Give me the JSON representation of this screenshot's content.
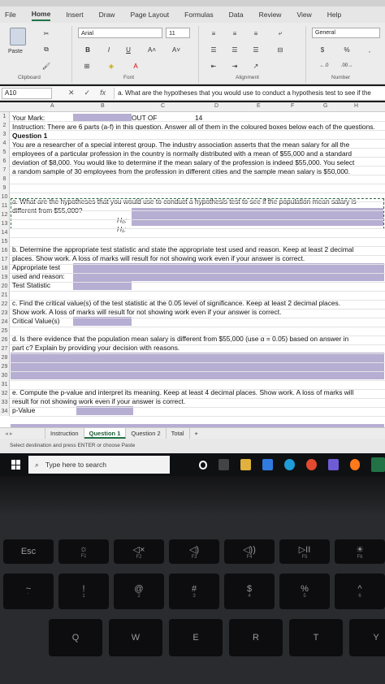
{
  "menu": {
    "items": [
      "File",
      "Home",
      "Insert",
      "Draw",
      "Page Layout",
      "Formulas",
      "Data",
      "Review",
      "View",
      "Help"
    ],
    "active": "Home"
  },
  "ribbon": {
    "paste_label": "Paste",
    "font_name": "Arial",
    "font_size": "11",
    "number_format": "General",
    "groups": [
      "Clipboard",
      "Font",
      "Alignment",
      "Number"
    ],
    "bold": "B",
    "italic": "I",
    "underline": "U",
    "currency": "$",
    "percent": "%"
  },
  "formula_bar": {
    "cell_ref": "A10",
    "cancel": "✕",
    "enter": "✓",
    "fx": "fx",
    "content": "a. What are the hypotheses that you would use to conduct a hypothesis test to see if the"
  },
  "columns": [
    "A",
    "B",
    "C",
    "D",
    "E",
    "F",
    "G",
    "H"
  ],
  "rows": {
    "numbers": [
      "1",
      "2",
      "3",
      "4",
      "5",
      "6",
      "7",
      "8",
      "9",
      "10",
      "11",
      "12",
      "13",
      "14",
      "15",
      "16",
      "17",
      "18",
      "19",
      "20",
      "21",
      "22",
      "23",
      "24",
      "25",
      "26",
      "27",
      "28",
      "29",
      "30",
      "31",
      "32",
      "33",
      "34"
    ],
    "r1_your_mark": "Your Mark:",
    "r1_out_of": "OUT OF",
    "r1_total": "14",
    "r2": "Instruction: There are 6 parts (a-f) in this question. Answer all of them in the coloured boxes below each of the questions.",
    "r3": "Question 1",
    "r4": "You are a researcher of a special interest group. The industry association asserts that the mean salary for all the",
    "r5": "employees of a particular profession in the country is normally distributed with a mean of $55,000 and a standard",
    "r6": "deviation of $8,000. You would like to determine if the mean salary of the profession is indeed $55,000. You select",
    "r7": "a random sample of 30 employees from the profession in different cities and the sample mean salary is $50,000.",
    "r10": "a. What are the hypotheses that you would use to conduct a hypothesis test to see if the population mean salary is",
    "r11": "different from $55,000?",
    "r12_label": "H₀:",
    "r13_label": "H₁:",
    "r15": "b. Determine the appropriate test statistic and state the appropriate test used and reason.  Keep at least 2 decimal",
    "r16": "places.  Show work.  A loss of marks will result for not showing work even if your answer is correct.",
    "r17": "Appropriate test",
    "r18": "used and reason:",
    "r19": "Test Statistic",
    "r21": "c. Find the critical value(s) of the test statistic at the 0.05 level of significance.  Keep at least 2 decimal places.",
    "r22": "Show work.  A loss of marks will result for not showing work even if your answer is correct.",
    "r23": "Critical Value(s)",
    "r25": "d. Is there evidence that the population mean salary is different from $55,000 (use α = 0.05) based on answer in",
    "r26": "part c?  Explain by providing your decision with reasons.",
    "r31": "e. Compute the p-value and interpret its meaning.  Keep at least 4 decimal places.  Show work.  A loss of marks will",
    "r32": "result for not showing work even if your answer is correct.",
    "r33": "p-Value"
  },
  "sheet_tabs": [
    "Instruction",
    "Question 1",
    "Question 2",
    "Total"
  ],
  "active_tab": "Question 1",
  "add_sheet": "+",
  "status_text": "Select destination and press ENTER or choose Paste",
  "taskbar": {
    "search_placeholder": "Type here to search"
  },
  "keyboard": {
    "fn_row": [
      {
        "main": "Esc",
        "sub": ""
      },
      {
        "main": "☼",
        "sub": "F1"
      },
      {
        "main": "◁×",
        "sub": "F2"
      },
      {
        "main": "◁)",
        "sub": "F3"
      },
      {
        "main": "◁))",
        "sub": "F4"
      },
      {
        "main": "▷II",
        "sub": "F5"
      },
      {
        "main": "☀",
        "sub": "F6"
      }
    ],
    "num_row": [
      {
        "top": "~",
        "bot": "`"
      },
      {
        "top": "!",
        "bot": "1"
      },
      {
        "top": "@",
        "bot": "2"
      },
      {
        "top": "#",
        "bot": "3"
      },
      {
        "top": "$",
        "bot": "4"
      },
      {
        "top": "%",
        "bot": "5"
      },
      {
        "top": "^",
        "bot": "6"
      }
    ],
    "letter_row": [
      "Q",
      "W",
      "E",
      "R",
      "T",
      "Y"
    ]
  },
  "colors": {
    "answer_box": "#b7aed3",
    "excel_green": "#217346"
  }
}
